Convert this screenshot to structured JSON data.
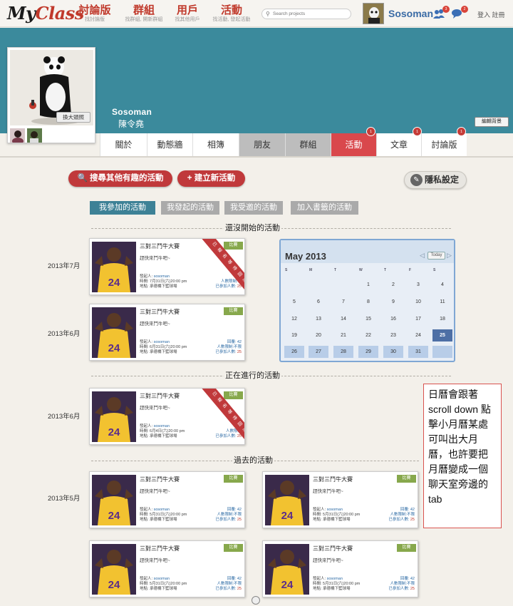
{
  "brand": {
    "logo_a": "My",
    "logo_b": "Class"
  },
  "nav": [
    {
      "title": "討論版",
      "sub": "找討論版"
    },
    {
      "title": "群組",
      "sub": "找群組, 開新群組"
    },
    {
      "title": "用戶",
      "sub": "找其他用戶"
    },
    {
      "title": "活動",
      "sub": "找活動, 發起活動"
    }
  ],
  "search": {
    "placeholder": "Search projects"
  },
  "user": {
    "name": "Sosoman",
    "badge1": "3",
    "badge2": "2",
    "login": "登入 註冊"
  },
  "profile": {
    "enlarge": "換大頭照",
    "name_en": "Sosoman",
    "name_zh": "陳令堯",
    "edit_bg": "編輯背景"
  },
  "tabs": [
    {
      "label": "關於"
    },
    {
      "label": "動態牆"
    },
    {
      "label": "相簿"
    },
    {
      "label": "朋友"
    },
    {
      "label": "群組"
    },
    {
      "label": "活動",
      "badge": "1"
    },
    {
      "label": "文章",
      "badge": "1"
    },
    {
      "label": "討論版",
      "badge": "1"
    }
  ],
  "buttons": {
    "search_events": "搜尋其他有趣的活動",
    "create_event": "建立新活動",
    "privacy": "隱私設定"
  },
  "filters": [
    "我參加的活動",
    "我發起的活動",
    "我受邀的活動",
    "加入書籤的活動"
  ],
  "sections": {
    "upcoming": "還沒開始的活動",
    "ongoing": "正在進行的活動",
    "past": "過去的活動"
  },
  "months": {
    "m1": "2013年7月",
    "m2": "2013年6月",
    "m3": "2013年6月",
    "m4": "2013年5月"
  },
  "cards": [
    {
      "title": "三對三鬥牛大賽",
      "sub": "趕快來鬥牛吧~",
      "tag": "比賽",
      "host": "sosoman",
      "host_label": "發起人:",
      "time": "時間: 7月31日(六)20:00 pm",
      "place": "地點: 承德橋下籃球場",
      "r1": "",
      "r2": "人數限制:不",
      "r3": "已參加人數:",
      "joined": "25",
      "ribbon": "已報名等待回應"
    },
    {
      "title": "三對三鬥牛大賽",
      "sub": "趕快來鬥牛吧~",
      "tag": "比賽",
      "host": "sosoman",
      "host_label": "發起人:",
      "time": "時間: 6月31日(六)20:00 pm",
      "place": "地點: 承德橋下籃球場",
      "r1": "回覆: 42",
      "r2": "人數限制:不限",
      "r3": "已參加人數:",
      "joined": "25"
    },
    {
      "title": "三對三鬥牛大賽",
      "sub": "趕快來鬥牛吧~",
      "tag": "比賽",
      "host": "sosoman",
      "host_label": "發起人:",
      "time": "時間: 6月4日(六)20:00 pm",
      "place": "地點: 承德橋下籃球場",
      "r1": "",
      "r2": "人數限制",
      "r3": "已參加人數:",
      "joined": "25",
      "ribbon": "已報名等待回應"
    },
    {
      "title": "三對三鬥牛大賽",
      "sub": "趕快來鬥牛吧~",
      "tag": "比賽",
      "host": "sosoman",
      "host_label": "發起人:",
      "time": "時間: 5月31日(六)20:00 pm",
      "place": "地點: 承德橋下籃球場",
      "r1": "回覆: 42",
      "r2": "人數限制:不限",
      "r3": "已參加人數:",
      "joined": "25"
    },
    {
      "title": "三對三鬥牛大賽",
      "sub": "趕快來鬥牛吧~",
      "tag": "比賽",
      "host": "sosoman",
      "host_label": "發起人:",
      "time": "時間: 5月31日(六)20:00 pm",
      "place": "地點: 承德橋下籃球場",
      "r1": "回覆: 42",
      "r2": "人數限制:不限",
      "r3": "已參加人數:",
      "joined": "25"
    },
    {
      "title": "三對三鬥牛大賽",
      "sub": "趕快來鬥牛吧~",
      "tag": "比賽",
      "host": "sosoman",
      "host_label": "發起人:",
      "time": "時間: 5月31日(六)20:00 pm",
      "place": "地點: 承德橋下籃球場",
      "r1": "回覆: 42",
      "r2": "人數限制:不限",
      "r3": "已參加人數:",
      "joined": "25"
    },
    {
      "title": "三對三鬥牛大賽",
      "sub": "趕快來鬥牛吧~",
      "tag": "比賽",
      "host": "sosoman",
      "host_label": "發起人:",
      "time": "時間: 5月31日(六)20:00 pm",
      "place": "地點: 承德橋下籃球場",
      "r1": "回覆: 42",
      "r2": "人數限制:不限",
      "r3": "已參加人數:",
      "joined": "25"
    }
  ],
  "calendar": {
    "title": "May 2013",
    "today_label": "Today",
    "dow": [
      "S",
      "M",
      "T",
      "W",
      "T",
      "F",
      "S"
    ],
    "weeks": [
      [
        "",
        "",
        "",
        "1",
        "2",
        "3",
        "4"
      ],
      [
        "5",
        "6",
        "7",
        "8",
        "9",
        "10",
        "11"
      ],
      [
        "12",
        "13",
        "14",
        "15",
        "16",
        "17",
        "18"
      ],
      [
        "19",
        "20",
        "21",
        "22",
        "23",
        "24",
        "25"
      ],
      [
        "26",
        "27",
        "28",
        "29",
        "30",
        "31",
        ""
      ]
    ],
    "today": "25"
  },
  "note": {
    "text": "日曆會跟著scroll down 點擊小月曆某處可叫出大月曆，也許要把月曆變成一個聊天室旁邊的tab"
  },
  "colors": {
    "accent": "#c0392b",
    "banner": "#3b8a9c",
    "active_filter": "#3d8196",
    "tag": "#87a84c"
  }
}
